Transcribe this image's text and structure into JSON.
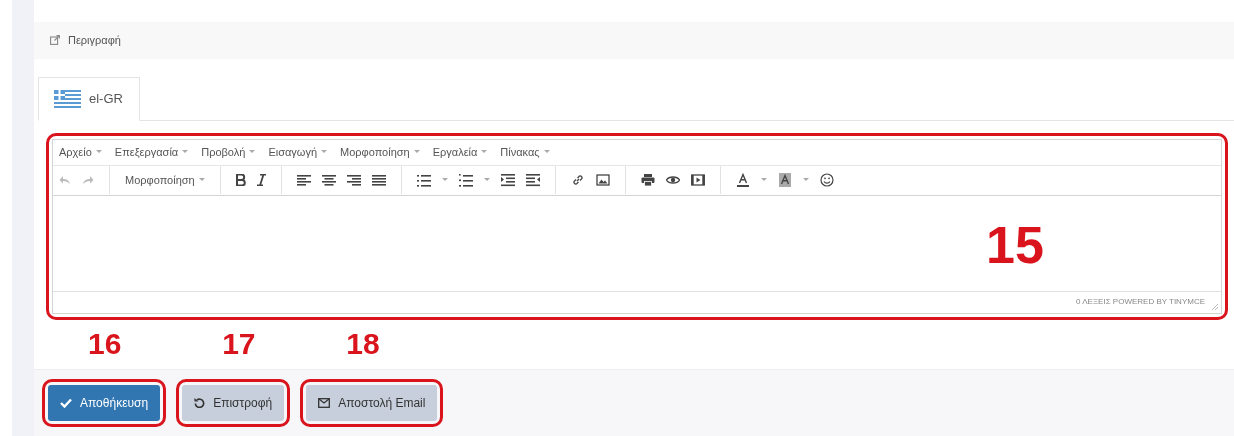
{
  "panel": {
    "title": "Περιγραφή"
  },
  "tabs": [
    {
      "label": "el-GR",
      "selected": true
    }
  ],
  "editor": {
    "menu": [
      "Αρχείο",
      "Επεξεργασία",
      "Προβολή",
      "Εισαγωγή",
      "Μορφοποίηση",
      "Εργαλεία",
      "Πίνακας"
    ],
    "toolbar": {
      "undo_disabled": true,
      "redo_disabled": true,
      "format_label": "Μορφοποίηση"
    },
    "status": "0 ΛΕΞΕΙΣ POWERED BY TINYMCE"
  },
  "buttons": [
    {
      "label": "Αποθήκευση",
      "kind": "primary"
    },
    {
      "label": "Επιστροφή",
      "kind": "back"
    },
    {
      "label": "Αποστολή Email",
      "kind": "email"
    }
  ],
  "annotations": [
    {
      "label": "15"
    },
    {
      "label": "16"
    },
    {
      "label": "17"
    },
    {
      "label": "18"
    }
  ]
}
